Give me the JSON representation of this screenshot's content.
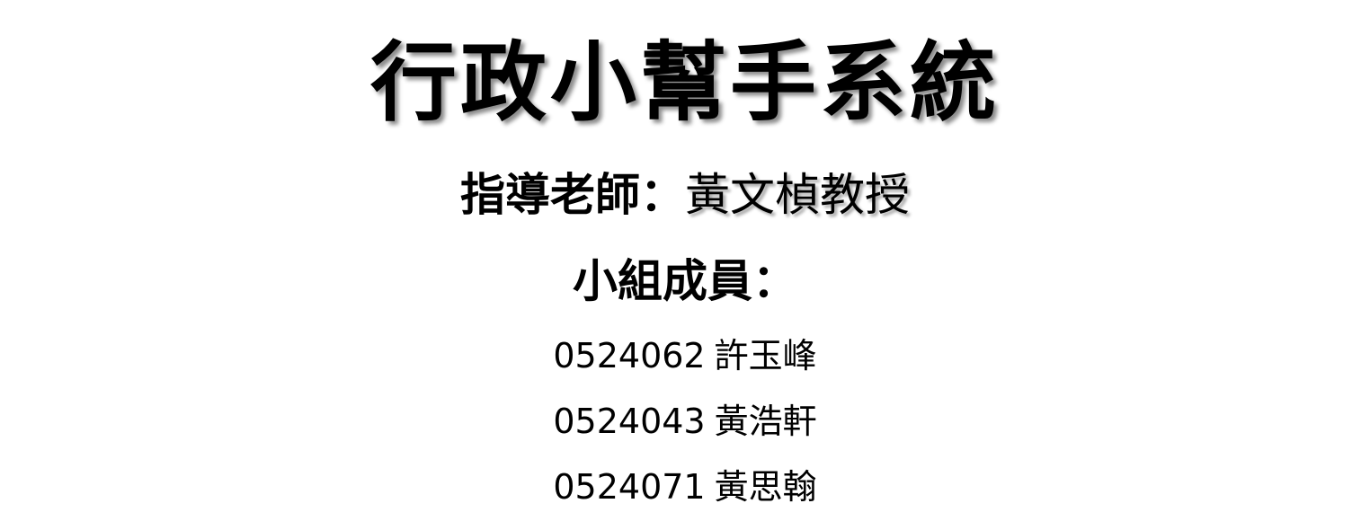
{
  "title": "行政小幫手系統",
  "advisor": {
    "label": "指導老師：",
    "name": "黃文楨教授"
  },
  "members": {
    "heading": "小組成員：",
    "list": [
      {
        "id": "0524062",
        "name": "許玉峰"
      },
      {
        "id": "0524043",
        "name": "黃浩軒"
      },
      {
        "id": "0524071",
        "name": "黃思翰"
      }
    ]
  }
}
